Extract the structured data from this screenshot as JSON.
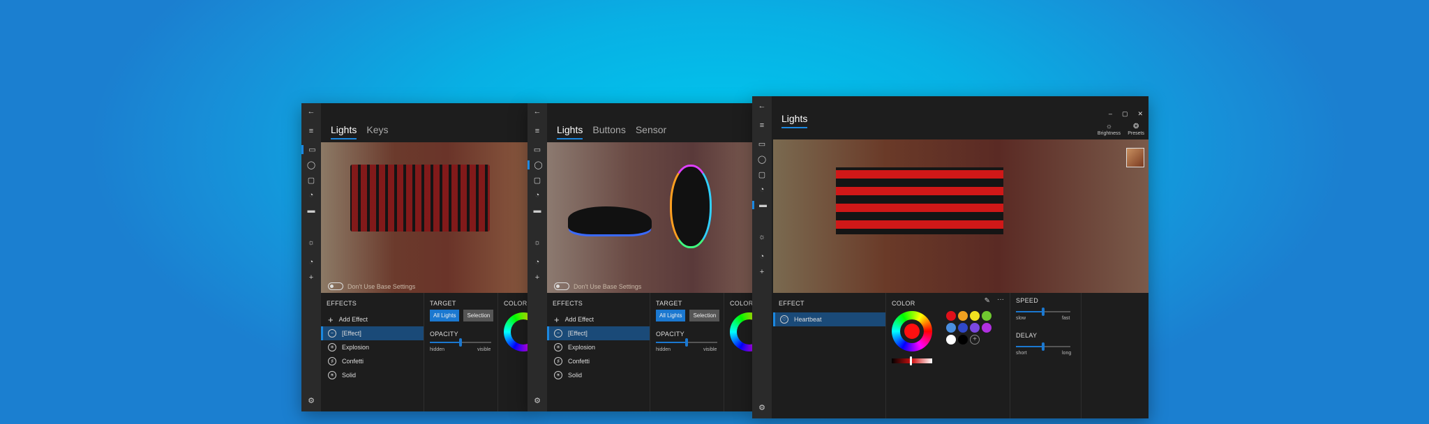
{
  "window1": {
    "tabs": [
      "Lights",
      "Keys"
    ],
    "toggle_label": "Don't Use Base Settings",
    "effects": {
      "title": "EFFECTS",
      "add": "Add Effect",
      "items": [
        "[Effect]",
        "Explosion",
        "Confetti",
        "Solid"
      ]
    },
    "target": {
      "title": "TARGET",
      "all_lights": "All Lights",
      "selection": "Selection"
    },
    "opacity": {
      "title": "OPACITY",
      "min": "hidden",
      "max": "visible",
      "value": 0.5
    },
    "color": {
      "title": "COLOR"
    }
  },
  "window2": {
    "tabs": [
      "Lights",
      "Buttons",
      "Sensor"
    ],
    "toggle_label": "Don't Use Base Settings",
    "effects": {
      "title": "EFFECTS",
      "add": "Add Effect",
      "items": [
        "[Effect]",
        "Explosion",
        "Confetti",
        "Solid"
      ]
    },
    "target": {
      "title": "TARGET",
      "all_lights": "All Lights",
      "selection": "Selection"
    },
    "opacity": {
      "title": "OPACITY",
      "min": "hidden",
      "max": "visible",
      "value": 0.5
    },
    "color": {
      "title": "COLOR"
    }
  },
  "window3": {
    "tabs": [
      "Lights"
    ],
    "toolbar": {
      "brightness": "Brightness",
      "presets": "Presets"
    },
    "effect": {
      "title": "EFFECT",
      "items": [
        "Heartbeat"
      ]
    },
    "color": {
      "title": "COLOR",
      "selected": "#ff1010",
      "swatches": [
        "#e0101a",
        "#f0a020",
        "#f0e020",
        "#70c830",
        "#4a8ee0",
        "#3048c8",
        "#7a48e0",
        "#b030e0",
        "#ffffff",
        "#000000"
      ]
    },
    "speed": {
      "title": "SPEED",
      "min": "slow",
      "max": "fast",
      "value": 0.5
    },
    "delay": {
      "title": "DELAY",
      "min": "short",
      "max": "long",
      "value": 0.5
    }
  },
  "colors": {
    "accent": "#1b88e0",
    "background": "#0ab4e6"
  }
}
